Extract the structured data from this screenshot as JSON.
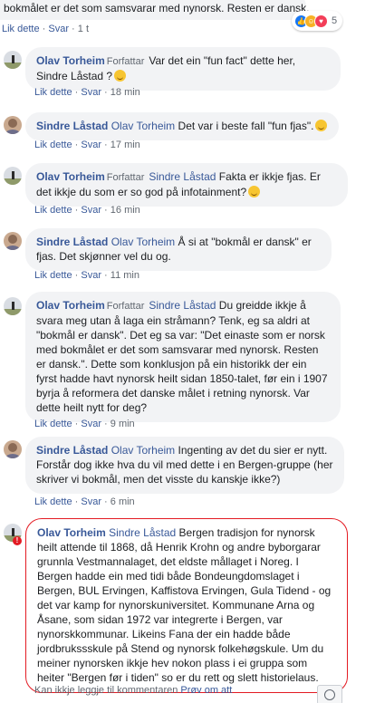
{
  "top": {
    "text": "bokmålet er det som samsvarar med nynorsk. Resten er dansk.",
    "reaction_count": "5",
    "like": "Lik dette",
    "reply": "Svar",
    "time": "1 t"
  },
  "comments": [
    {
      "author": "Olav Torheim",
      "badge": "Forfattar",
      "mention": "",
      "text": "Var det ein \"fun fact\" dette her, Sindre Låstad ?",
      "emoji": true,
      "like": "Lik dette",
      "reply": "Svar",
      "time": "18 min"
    },
    {
      "author": "Sindre Låstad",
      "badge": "",
      "mention": "Olav Torheim",
      "text": "Det var i beste fall \"fun fjas\".",
      "emoji": true,
      "like": "Lik dette",
      "reply": "Svar",
      "time": "17 min"
    },
    {
      "author": "Olav Torheim",
      "badge": "Forfattar",
      "mention": "Sindre Låstad",
      "text": "Fakta er ikkje fjas. Er det ikkje du som er so god på infotainment?",
      "emoji": true,
      "like": "Lik dette",
      "reply": "Svar",
      "time": "16 min"
    },
    {
      "author": "Sindre Låstad",
      "badge": "",
      "mention": "Olav Torheim",
      "text": "Å si at \"bokmål er dansk\" er fjas. Det skjønner vel du og.",
      "emoji": false,
      "like": "Lik dette",
      "reply": "Svar",
      "time": "11 min"
    },
    {
      "author": "Olav Torheim",
      "badge": "Forfattar",
      "mention": "Sindre Låstad",
      "text": "Du greidde ikkje å svara meg utan å laga ein stråmann? Tenk, eg sa aldri at \"bokmål er dansk\". Det eg sa var: \"Det einaste som er norsk med bokmålet er det som samsvarar med nynorsk. Resten er dansk.\". Dette som konklusjon på ein historikk der ein fyrst hadde havt nynorsk heilt sidan 1850-talet, før ein i 1907 byrja å reformera det danske målet i retning nynorsk. Var dette heilt nytt for deg?",
      "emoji": false,
      "like": "Lik dette",
      "reply": "Svar",
      "time": "9 min"
    },
    {
      "author": "Sindre Låstad",
      "badge": "",
      "mention": "Olav Torheim",
      "text": "Ingenting av det du sier er nytt. Forstår dog ikke hva du vil med dette i en Bergen-gruppe (her skriver vi bokmål, men det visste du kanskje ikke?)",
      "emoji": false,
      "like": "Lik dette",
      "reply": "Svar",
      "time": "6 min"
    },
    {
      "author": "Olav Torheim",
      "badge": "",
      "mention": "Sindre Låstad",
      "text": "Bergen tradisjon for nynorsk heilt attende til 1868, då Henrik Krohn og andre byborgarar grunnla Vestmannalaget, det eldste mållaget i Noreg. I Bergen hadde ein med tidi både Bondeungdomslaget i Bergen, BUL Ervingen, Kaffistova Ervingen, Gula Tidend - og det var kamp for nynorskuniversitet. Kommunane Arna og Åsane, som sidan 1972 var integrerte i Bergen, var nynorskkommunar. Likeins Fana der ein hadde både jordbrukssskule på Stend og nynorsk folkehøgskule. Um du meiner nynorsken ikkje hev nokon plass i ei gruppa som heiter \"Bergen før i tiden\" so er du rett og slett historielaus.",
      "emoji": false,
      "error": true
    }
  ],
  "footer": {
    "error_text": "Kan ikkje leggje til kommentaren",
    "retry": "Prøv om att"
  },
  "colors": {
    "link": "#385898",
    "bubble": "#f2f3f5",
    "error": "#e31b23",
    "meta": "#606770"
  }
}
